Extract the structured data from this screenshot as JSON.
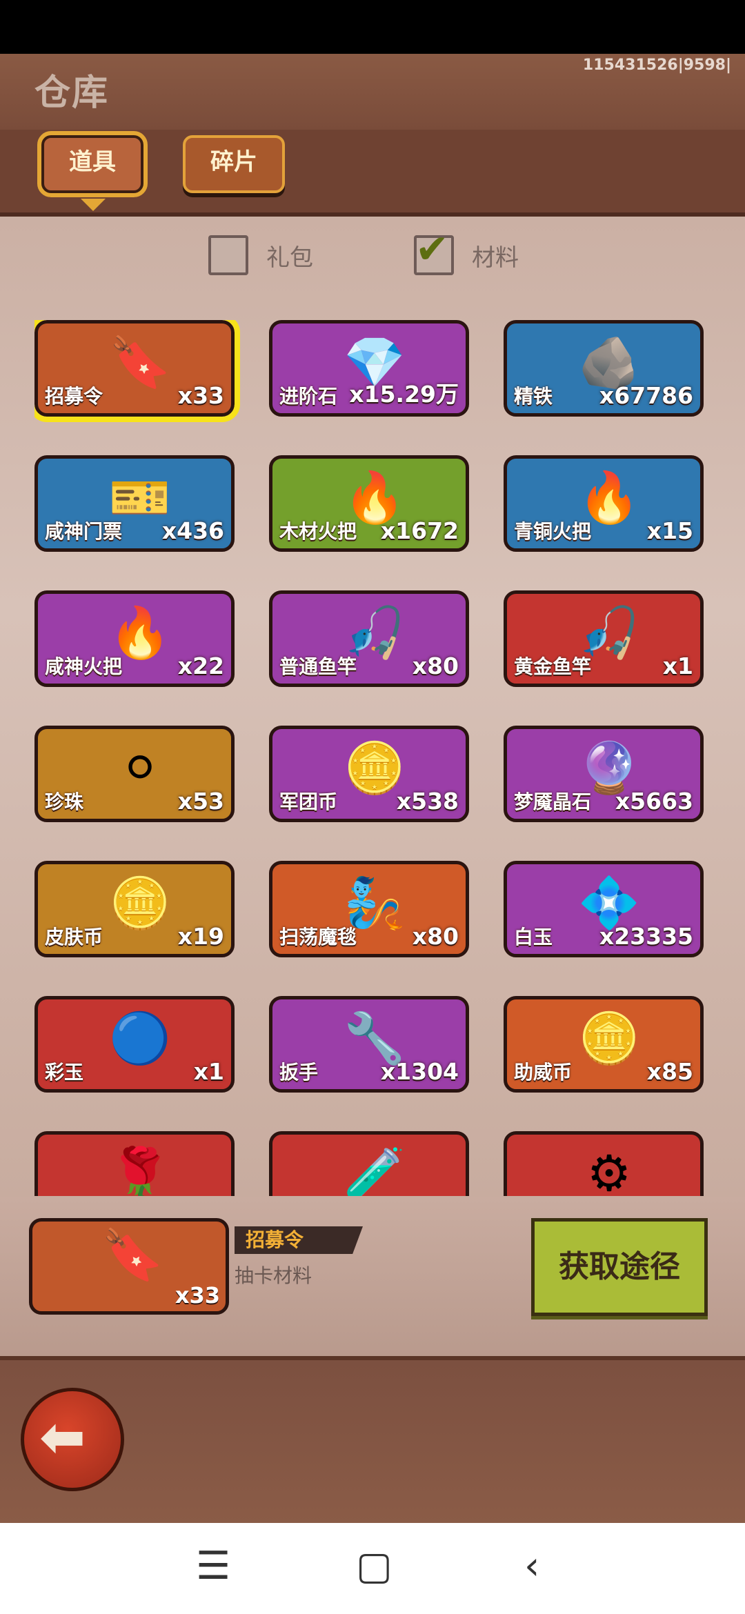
{
  "header": {
    "title": "仓库",
    "uid": "115431526|9598|"
  },
  "tabs": [
    {
      "label": "道具",
      "active": true
    },
    {
      "label": "碎片",
      "active": false
    }
  ],
  "filters": [
    {
      "label": "礼包",
      "checked": false
    },
    {
      "label": "材料",
      "checked": true
    }
  ],
  "items": [
    {
      "name": "招募令",
      "count": "x33",
      "icon": "recruit-token-icon",
      "glyph": "🔖",
      "bg": "#c1582b",
      "selected": true
    },
    {
      "name": "进阶石",
      "count": "x15.29万",
      "icon": "advance-stone-icon",
      "glyph": "💎",
      "bg": "#9b3ea8"
    },
    {
      "name": "精铁",
      "count": "x67786",
      "icon": "iron-ore-icon",
      "glyph": "🪨",
      "bg": "#2f78b0"
    },
    {
      "name": "咸神门票",
      "count": "x436",
      "icon": "ticket-icon",
      "glyph": "🎫",
      "bg": "#2f78b0"
    },
    {
      "name": "木材火把",
      "count": "x1672",
      "icon": "wooden-torch-icon",
      "glyph": "🔥",
      "bg": "#74a02c"
    },
    {
      "name": "青铜火把",
      "count": "x15",
      "icon": "bronze-torch-icon",
      "glyph": "🔥",
      "bg": "#2f78b0"
    },
    {
      "name": "咸神火把",
      "count": "x22",
      "icon": "gold-torch-icon",
      "glyph": "🔥",
      "bg": "#9b3ea8"
    },
    {
      "name": "普通鱼竿",
      "count": "x80",
      "icon": "fishing-rod-icon",
      "glyph": "🎣",
      "bg": "#9b3ea8"
    },
    {
      "name": "黄金鱼竿",
      "count": "x1",
      "icon": "golden-rod-icon",
      "glyph": "🎣",
      "bg": "#c43530"
    },
    {
      "name": "珍珠",
      "count": "x53",
      "icon": "pearl-icon",
      "glyph": "⚪",
      "bg": "#c08224"
    },
    {
      "name": "军团币",
      "count": "x538",
      "icon": "legion-coin-icon",
      "glyph": "🪙",
      "bg": "#9b3ea8"
    },
    {
      "name": "梦魇晶石",
      "count": "x5663",
      "icon": "nightmare-crystal-icon",
      "glyph": "🔮",
      "bg": "#9b3ea8"
    },
    {
      "name": "皮肤币",
      "count": "x19",
      "icon": "skin-coin-icon",
      "glyph": "🪙",
      "bg": "#c08224"
    },
    {
      "name": "扫荡魔毯",
      "count": "x80",
      "icon": "magic-carpet-icon",
      "glyph": "🧞",
      "bg": "#d05a28"
    },
    {
      "name": "白玉",
      "count": "x23335",
      "icon": "white-jade-icon",
      "glyph": "💠",
      "bg": "#9b3ea8"
    },
    {
      "name": "彩玉",
      "count": "x1",
      "icon": "rainbow-jade-icon",
      "glyph": "🔵",
      "bg": "#c43530"
    },
    {
      "name": "扳手",
      "count": "x1304",
      "icon": "wrench-icon",
      "glyph": "🔧",
      "bg": "#9b3ea8"
    },
    {
      "name": "助威币",
      "count": "x85",
      "icon": "cheer-coin-icon",
      "glyph": "🪙",
      "bg": "#d05a28"
    },
    {
      "name": "",
      "count": "",
      "icon": "rose-icon",
      "glyph": "🌹",
      "bg": "#c43530"
    },
    {
      "name": "",
      "count": "",
      "icon": "scroll-tube-icon",
      "glyph": "🧪",
      "bg": "#c43530"
    },
    {
      "name": "",
      "count": "",
      "icon": "fan-coin-icon",
      "glyph": "⚙",
      "bg": "#c43530"
    }
  ],
  "detail": {
    "name": "招募令",
    "count": "x33",
    "description": "抽卡材料",
    "get_button": "获取途径"
  },
  "navbar": {
    "menu": "☰",
    "home": "▢",
    "back": "‹"
  },
  "colors": {
    "selected_outline": "#f7e21a",
    "get_button": "#aabc37"
  }
}
